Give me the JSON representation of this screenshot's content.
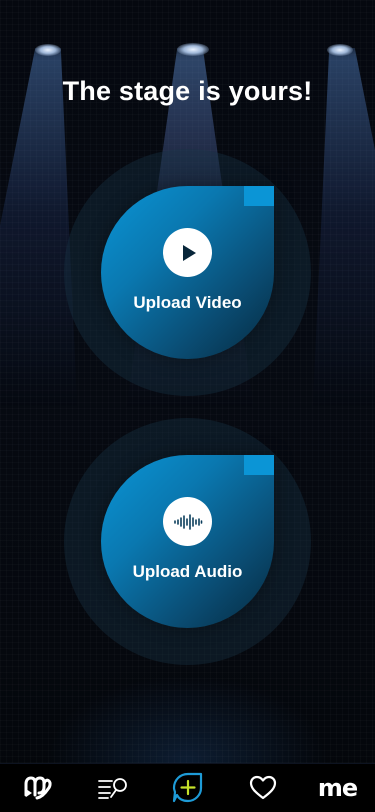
{
  "headline": "The stage is yours!",
  "upload_video": {
    "label": "Upload Video",
    "icon": "play-icon"
  },
  "upload_audio": {
    "label": "Upload Audio",
    "icon": "audio-waveform-icon"
  },
  "tabbar": {
    "items": [
      {
        "icon": "app-logo-icon"
      },
      {
        "icon": "playlist-search-icon"
      },
      {
        "icon": "create-plus-icon",
        "accent": "#1e9bd7",
        "plus_color": "#c6e22a"
      },
      {
        "icon": "heart-icon"
      },
      {
        "label": "me"
      }
    ]
  },
  "colors": {
    "background": "#03070d",
    "accent_blue": "#0b95d6",
    "text": "#ffffff"
  }
}
